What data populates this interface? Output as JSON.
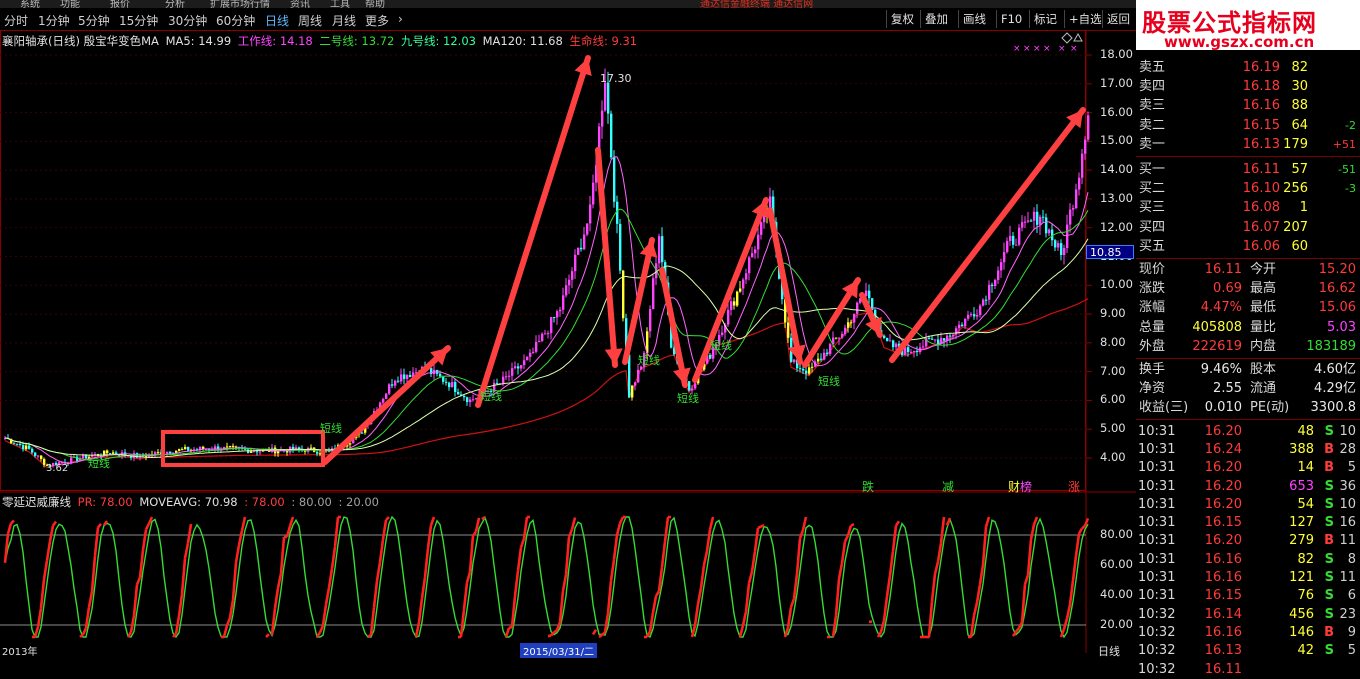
{
  "menubar": {
    "items": [
      "系统",
      "功能",
      "报价",
      "分析",
      "扩展市场行情",
      "资讯",
      "工具",
      "帮助"
    ],
    "promo": "通达信金融终端 通达信网"
  },
  "toolbar": {
    "periods": [
      "分时",
      "1分钟",
      "5分钟",
      "15分钟",
      "30分钟",
      "60分钟",
      "日线",
      "周线",
      "月线",
      "更多"
    ],
    "more_arrow": "›",
    "active_period": "日线",
    "buttons": [
      "复权",
      "叠加",
      "画线",
      "F10",
      "标记",
      "+自选",
      "返回"
    ]
  },
  "logo": {
    "line1": "股票公式指标网",
    "line2": "www.gszx.com.cn"
  },
  "chart_info": {
    "title": "襄阳轴承(日线) 殷宝华变色MA",
    "ma5": "MA5: 14.99",
    "work": "工作线: 14.18",
    "line2": "二号线: 13.72",
    "line9": "九号线: 12.03",
    "ma120": "MA120: 11.68",
    "life": "生命线: 9.31"
  },
  "osc_info": {
    "title": "零延迟威廉线",
    "pr": "PR: 78.00",
    "moveavg": "MOVEAVG: 70.98",
    "v78": ": 78.00",
    "v80": ": 80.00",
    "v20": ": 20.00"
  },
  "colors": {
    "up": "#ff3b3b",
    "down": "#33ffff",
    "magenta": "#ff44ff",
    "arrow": "#ff4040",
    "ma_life": "#cc1111"
  },
  "main_axis": [
    "18.00",
    "17.00",
    "16.00",
    "15.00",
    "14.00",
    "13.00",
    "12.00",
    "11.00",
    "10.00",
    "9.00",
    "8.00",
    "7.00",
    "6.00",
    "5.00",
    "4.00"
  ],
  "osc_axis": [
    "80.00",
    "60.00",
    "40.00",
    "20.00"
  ],
  "current_price_tag": "10.85",
  "annotations": {
    "high": "17.30",
    "low": "3.62",
    "short_label": "短线"
  },
  "signals": [
    {
      "text": "跌",
      "color": "#33dd33"
    },
    {
      "text": "减",
      "color": "#33dd33"
    },
    {
      "text": "财",
      "color": "#ffff33"
    },
    {
      "text": "榜",
      "color": "#ff44ff"
    },
    {
      "text": "涨",
      "color": "#ff3b3b"
    }
  ],
  "bottom": {
    "date_left": "2013年",
    "date_mid": "2015/03/31/二",
    "period": "日线"
  },
  "order_book": {
    "asks": [
      {
        "label": "卖五",
        "price": "16.19",
        "vol": "82",
        "chg": ""
      },
      {
        "label": "卖四",
        "price": "16.18",
        "vol": "30",
        "chg": ""
      },
      {
        "label": "卖三",
        "price": "16.16",
        "vol": "88",
        "chg": ""
      },
      {
        "label": "卖二",
        "price": "16.15",
        "vol": "64",
        "chg": "-2"
      },
      {
        "label": "卖一",
        "price": "16.13",
        "vol": "179",
        "chg": "+51"
      }
    ],
    "bids": [
      {
        "label": "买一",
        "price": "16.11",
        "vol": "57",
        "chg": "-51"
      },
      {
        "label": "买二",
        "price": "16.10",
        "vol": "256",
        "chg": "-3"
      },
      {
        "label": "买三",
        "price": "16.08",
        "vol": "1",
        "chg": ""
      },
      {
        "label": "买四",
        "price": "16.07",
        "vol": "207",
        "chg": ""
      },
      {
        "label": "买五",
        "price": "16.06",
        "vol": "60",
        "chg": ""
      }
    ]
  },
  "quote": [
    {
      "l1": "现价",
      "v1": "16.11",
      "c1": "red",
      "l2": "今开",
      "v2": "15.20",
      "c2": "red"
    },
    {
      "l1": "涨跌",
      "v1": "0.69",
      "c1": "red",
      "l2": "最高",
      "v2": "16.62",
      "c2": "red"
    },
    {
      "l1": "涨幅",
      "v1": "4.47%",
      "c1": "red",
      "l2": "最低",
      "v2": "15.06",
      "c2": "red"
    },
    {
      "l1": "总量",
      "v1": "405808",
      "c1": "yel",
      "l2": "量比",
      "v2": "5.03",
      "c2": "mag"
    },
    {
      "l1": "外盘",
      "v1": "222619",
      "c1": "red",
      "l2": "内盘",
      "v2": "183189",
      "c2": "grn"
    },
    {
      "l1": "换手",
      "v1": "9.46%",
      "c1": "wht",
      "l2": "股本",
      "v2": "4.60亿",
      "c2": "wht"
    },
    {
      "l1": "净资",
      "v1": "2.55",
      "c1": "wht",
      "l2": "流通",
      "v2": "4.29亿",
      "c2": "wht"
    },
    {
      "l1": "收益(三)",
      "v1": "0.010",
      "c1": "wht",
      "l2": "PE(动)",
      "v2": "3300.8",
      "c2": "wht"
    }
  ],
  "ticks": [
    {
      "t": "10:31",
      "p": "16.20",
      "v": "48",
      "vc": "yel",
      "bs": "S",
      "n": "10"
    },
    {
      "t": "10:31",
      "p": "16.24",
      "v": "388",
      "vc": "yel",
      "bs": "B",
      "n": "28"
    },
    {
      "t": "10:31",
      "p": "16.20",
      "v": "14",
      "vc": "yel",
      "bs": "B",
      "n": "5"
    },
    {
      "t": "10:31",
      "p": "16.20",
      "v": "653",
      "vc": "mag",
      "bs": "S",
      "n": "36"
    },
    {
      "t": "10:31",
      "p": "16.20",
      "v": "54",
      "vc": "yel",
      "bs": "S",
      "n": "10"
    },
    {
      "t": "10:31",
      "p": "16.15",
      "v": "127",
      "vc": "yel",
      "bs": "S",
      "n": "16"
    },
    {
      "t": "10:31",
      "p": "16.20",
      "v": "279",
      "vc": "yel",
      "bs": "B",
      "n": "11"
    },
    {
      "t": "10:31",
      "p": "16.16",
      "v": "82",
      "vc": "yel",
      "bs": "S",
      "n": "8"
    },
    {
      "t": "10:31",
      "p": "16.16",
      "v": "121",
      "vc": "yel",
      "bs": "S",
      "n": "11"
    },
    {
      "t": "10:31",
      "p": "16.15",
      "v": "76",
      "vc": "yel",
      "bs": "S",
      "n": "6"
    },
    {
      "t": "10:32",
      "p": "16.14",
      "v": "456",
      "vc": "yel",
      "bs": "S",
      "n": "23"
    },
    {
      "t": "10:32",
      "p": "16.16",
      "v": "146",
      "vc": "yel",
      "bs": "B",
      "n": "9"
    },
    {
      "t": "10:32",
      "p": "16.13",
      "v": "42",
      "vc": "yel",
      "bs": "S",
      "n": "5"
    },
    {
      "t": "10:32",
      "p": "16.11",
      "v": "",
      "vc": "yel",
      "bs": "",
      "n": ""
    }
  ]
}
